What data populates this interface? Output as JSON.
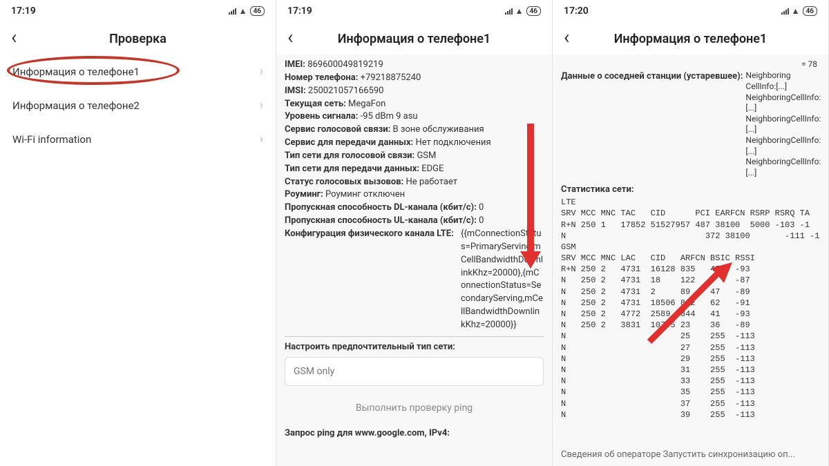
{
  "statusbar": {
    "time1": "17:19",
    "time2": "17:19",
    "time3": "17:20",
    "battery": "46"
  },
  "screen1": {
    "title": "Проверка",
    "items": [
      "Информация о телефоне1",
      "Информация о телефоне2",
      "Wi-Fi information"
    ]
  },
  "screen2": {
    "title": "Информация о телефоне1",
    "kv": [
      {
        "l": "IMEI:",
        "v": " 869600049819219"
      },
      {
        "l": "Номер телефона:",
        "v": " +79218875240"
      },
      {
        "l": "IMSI:",
        "v": " 250021057166590"
      },
      {
        "l": "Текущая сеть:",
        "v": " MegaFon"
      },
      {
        "l": "Уровень сигнала:",
        "v": " -95 dBm   9 asu"
      },
      {
        "l": "Сервис голосовой связи:",
        "v": " В зоне обслуживания"
      },
      {
        "l": "Сервис для передачи данных:",
        "v": " Нет подключения"
      },
      {
        "l": "Тип сети для голосовой связи:",
        "v": " GSM"
      },
      {
        "l": "Тип сети для передачи данных:",
        "v": " EDGE"
      },
      {
        "l": "Статус голосовых вызовов:",
        "v": " Не работает"
      },
      {
        "l": "Роуминг:",
        "v": " Роуминг отключен"
      },
      {
        "l": "Пропускная способность DL-канала (кбит/с):",
        "v": " 0"
      },
      {
        "l": "Пропускная способность UL-канала (кбит/с):",
        "v": " 0"
      },
      {
        "l": "Конфигурация физического канала LTE:",
        "v": " {{mConnectionStatus=PrimaryServing,mCellBandwidthDownlinkKhz=20000},{mConnectionStatus=SecondaryServing,mCellBandwidthDownlinkKhz=20000}}"
      }
    ],
    "prefType": {
      "label": "Настроить предпочтительный тип сети:",
      "value": "GSM only"
    },
    "pingBtn": "Выполнить проверку ping",
    "pingQuery": "Запрос ping для www.google.com, IPv4:"
  },
  "screen3": {
    "title": "Информация о телефоне1",
    "topEq": "= 78",
    "neighbor": {
      "label": "Данные о соседней станции (устаревшее):",
      "value": "Neighboring CellInfo:[...] NeighboringCellInfo:[...] NeighboringCellInfo:[...] NeighboringCellInfo:[...] NeighboringCellInfo: [...]"
    },
    "statsTitle": "Статистика сети:",
    "lteHeader": "LTE\nSRV MCC MNC TAC   CID      PCI EARFCN RSRP RSRQ TA",
    "lteRows": "R+N 250 1   17852 51527957 487 38100  5000 -103 -1\nN                            372 38100       -111 -1",
    "gsmHeader": "GSM\nSRV MCC MNC LAC   CID   ARFCN BSIC RSSI",
    "gsmRows": "R+N 250 2   4731  16128 835   45   -93\nN   250 2   4731  18    122   7    -87\nN   250 2   4731  2     89    47   -89\nN   250 2   4731  18506 842   62   -91\nN   250 2   4772  2589  844   41   -93\nN   250 2   3831  10795 23    36   -89\nN                       25    255  -113\nN                       27    255  -113\nN                       29    255  -113\nN                       31    255  -113\nN                       33    255  -113\nN                       35    255  -113\nN                       37    255  -113\nN                       39    255  -113",
    "footer": "Сведения об операторе Запустить синхронизацию оп..."
  }
}
